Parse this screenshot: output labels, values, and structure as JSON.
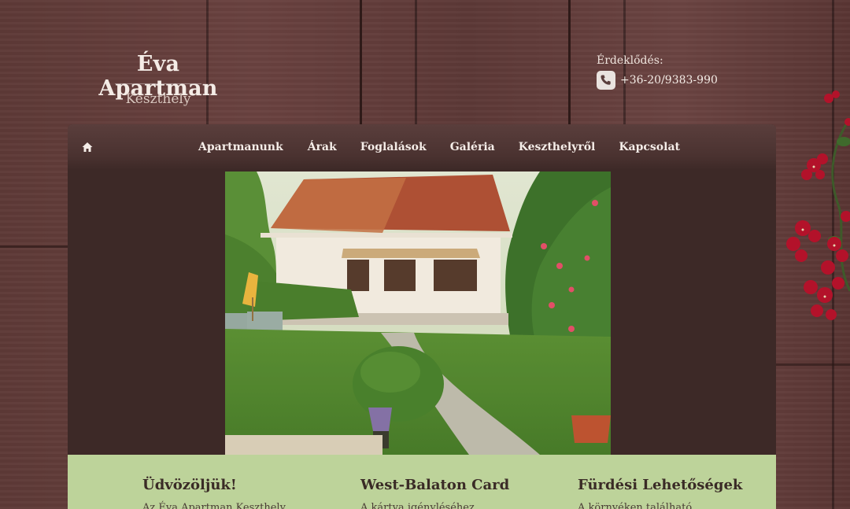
{
  "header": {
    "title": "Éva Apartman",
    "subtitle": "Keszthely",
    "contact_label": "Érdeklődés:",
    "phone": "+36-20/9383-990"
  },
  "nav": {
    "items": [
      {
        "label": "Apartmanunk"
      },
      {
        "label": "Árak"
      },
      {
        "label": "Foglalások"
      },
      {
        "label": "Galéria"
      },
      {
        "label": "Keszthelyről"
      },
      {
        "label": "Kapcsolat"
      }
    ]
  },
  "columns": [
    {
      "title": "Üdvözöljük!",
      "text": "Az Éva Apartman Keszthely"
    },
    {
      "title": "West-Balaton Card",
      "text": "A kártya igényléséhez"
    },
    {
      "title": "Fürdési Lehetőségek",
      "text": "A környéken található"
    }
  ],
  "colors": {
    "wood": "#5e3a37",
    "panel": "#3d2927",
    "nav": "#4a3230",
    "footer_green": "#bdd39a"
  },
  "icons": {
    "home": "home-icon",
    "phone": "phone-icon"
  }
}
